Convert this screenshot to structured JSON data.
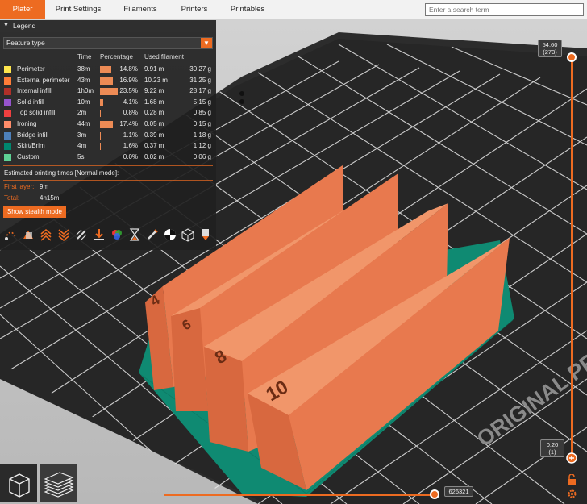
{
  "tabs": [
    {
      "label": "Plater",
      "active": true
    },
    {
      "label": "Print Settings",
      "active": false
    },
    {
      "label": "Filaments",
      "active": false
    },
    {
      "label": "Printers",
      "active": false
    },
    {
      "label": "Printables",
      "active": false
    }
  ],
  "search": {
    "placeholder": "Enter a search term"
  },
  "legend": {
    "title": "Legend",
    "view_type": "Feature type",
    "columns": {
      "time": "Time",
      "percentage": "Percentage",
      "used_filament": "Used filament"
    },
    "rows": [
      {
        "name": "Perimeter",
        "time": "38m",
        "pct": "14.8%",
        "percent": 14.8,
        "length": "9.91 m",
        "weight": "30.27 g",
        "color": "#ffe64d"
      },
      {
        "name": "External perimeter",
        "time": "43m",
        "pct": "16.9%",
        "percent": 16.9,
        "length": "10.23 m",
        "weight": "31.25 g",
        "color": "#ff7d38"
      },
      {
        "name": "Internal infill",
        "time": "1h0m",
        "pct": "23.5%",
        "percent": 23.5,
        "length": "9.22 m",
        "weight": "28.17 g",
        "color": "#b03029"
      },
      {
        "name": "Solid infill",
        "time": "10m",
        "pct": "4.1%",
        "percent": 4.1,
        "length": "1.68 m",
        "weight": "5.15 g",
        "color": "#9654cc"
      },
      {
        "name": "Top solid infill",
        "time": "2m",
        "pct": "0.8%",
        "percent": 0.8,
        "length": "0.28 m",
        "weight": "0.85 g",
        "color": "#f04040"
      },
      {
        "name": "Ironing",
        "time": "44m",
        "pct": "17.4%",
        "percent": 17.4,
        "length": "0.05 m",
        "weight": "0.15 g",
        "color": "#ff8c69"
      },
      {
        "name": "Bridge infill",
        "time": "3m",
        "pct": "1.1%",
        "percent": 1.1,
        "length": "0.39 m",
        "weight": "1.18 g",
        "color": "#4d80ba"
      },
      {
        "name": "Skirt/Brim",
        "time": "4m",
        "pct": "1.6%",
        "percent": 1.6,
        "length": "0.37 m",
        "weight": "1.12 g",
        "color": "#00876e"
      },
      {
        "name": "Custom",
        "time": "5s",
        "pct": "0.0%",
        "percent": 0.0,
        "length": "0.02 m",
        "weight": "0.06 g",
        "color": "#5ed194"
      }
    ],
    "estimated_title": "Estimated printing times [Normal mode]:",
    "first_layer_label": "First layer:",
    "first_layer_value": "9m",
    "total_label": "Total:",
    "total_value": "4h15m",
    "stealth_button": "Show stealth mode",
    "toolbar_icons": [
      "travel-icon",
      "wipe-icon",
      "retractions-icon",
      "deretractions-icon",
      "seams-icon",
      "tool-changes-icon",
      "color-changes-icon",
      "pause-prints-icon",
      "custom-gcodes-icon",
      "center-of-gravity-icon",
      "shells-icon",
      "tool-marker-icon"
    ]
  },
  "layer_slider": {
    "top_value": "54.60",
    "top_layer": "(273)",
    "bottom_value": "0.20",
    "bottom_layer": "(1)"
  },
  "move_slider": {
    "value": "626321"
  },
  "bed_text": "ORIGINAL PRUSA",
  "model_labels": [
    "4",
    "6",
    "8",
    "10"
  ],
  "colors": {
    "accent": "#ed6b21",
    "model": "#e8794e",
    "brim": "#0f8a72"
  }
}
